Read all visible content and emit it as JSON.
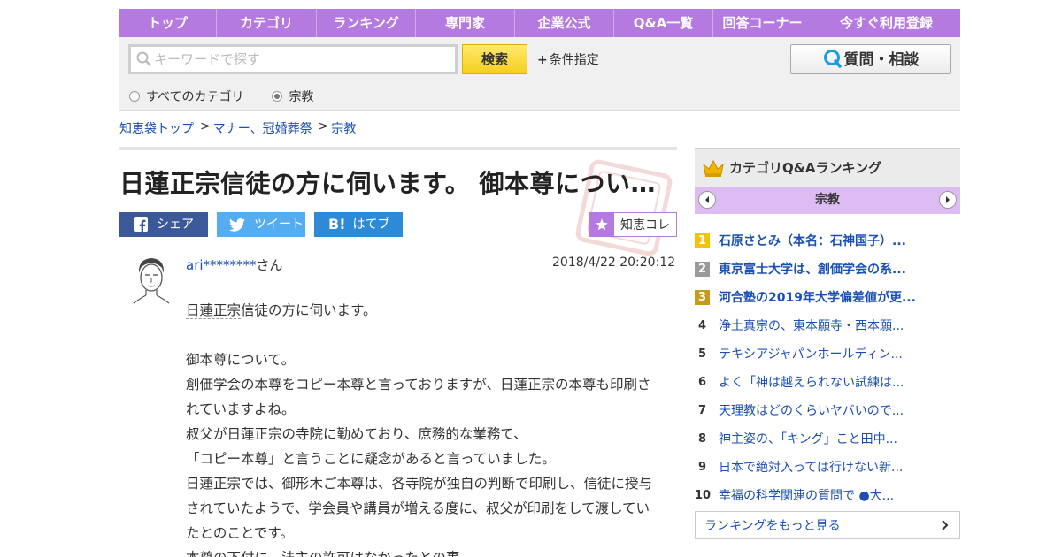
{
  "nav": {
    "items": [
      {
        "label": "トップ"
      },
      {
        "label": "カテゴリ"
      },
      {
        "label": "ランキング"
      },
      {
        "label": "専門家"
      },
      {
        "label": "企業公式"
      },
      {
        "label": "Q&A一覧"
      },
      {
        "label": "回答コーナー"
      },
      {
        "label": "今すぐ利用登録"
      }
    ]
  },
  "search": {
    "placeholder": "キーワードで探す",
    "button": "検索",
    "condition": "条件指定",
    "ask_button": "質問・相談",
    "scope_all": "すべてのカテゴリ",
    "scope_current": "宗教",
    "selected_scope": "current"
  },
  "breadcrumb": {
    "items": [
      {
        "label": "知恵袋トップ"
      },
      {
        "label": "マナー、冠婚葬祭"
      },
      {
        "label": "宗教"
      }
    ],
    "separator": ">"
  },
  "question": {
    "title": "日蓮正宗信徒の方に伺います。 御本尊につい…",
    "user": "ari********",
    "user_suffix": "さん",
    "date": "2018/4/22  20:20:12",
    "paragraphs": [
      {
        "kw": "日蓮正宗",
        "rest": "信徒の方に伺います。"
      },
      {
        "kw": "",
        "rest": ""
      },
      {
        "kw": "",
        "rest": "御本尊について。"
      },
      {
        "kw": "創価学会",
        "rest": "の本尊をコピー本尊と言っておりますが、日蓮正宗の本尊も印刷されていますよね。"
      },
      {
        "kw": "",
        "rest": "叔父が日蓮正宗の寺院に勤めており、庶務的な業務て、"
      },
      {
        "kw": "",
        "rest": "「コピー本尊」と言うことに疑念があると言っていました。"
      },
      {
        "kw": "",
        "rest": "日蓮正宗では、御形木ご本尊は、各寺院が独自の判断で印刷し、信徒に授与されていたようで、学会員や講員が増える度に、叔父が印刷をして渡していたとのことです。"
      },
      {
        "kw": "",
        "rest": "本尊の下付に、法主の許可はなかったとの事。"
      }
    ]
  },
  "share": {
    "facebook": "シェア",
    "twitter": "ツイート",
    "hatena_mark": "B!",
    "hatena": "はてブ",
    "chiecore": "知恵コレ"
  },
  "ranking": {
    "title": "カテゴリQ&Aランキング",
    "category": "宗教",
    "items": [
      {
        "rank": "1",
        "label": "石原さとみ（本名：石神国子）..."
      },
      {
        "rank": "2",
        "label": "東京富士大学は、創価学会の系..."
      },
      {
        "rank": "3",
        "label": "河合塾の2019年大学偏差値が更..."
      },
      {
        "rank": "4",
        "label": "浄土真宗の、東本願寺・西本願..."
      },
      {
        "rank": "5",
        "label": "テキシアジャパンホールディン..."
      },
      {
        "rank": "6",
        "label": "よく「神は越えられない試練は..."
      },
      {
        "rank": "7",
        "label": "天理教はどのくらいヤバいので..."
      },
      {
        "rank": "8",
        "label": "神主姿の、「キング」こと田中..."
      },
      {
        "rank": "9",
        "label": "日本で絶対入っては行けない新..."
      },
      {
        "rank": "10",
        "label": "幸福の科学関連の質問で ●大..."
      }
    ],
    "more": "ランキングをもっと見る"
  },
  "colors": {
    "nav": "#b57ae0",
    "link": "#1a4fb3",
    "search_button": "#f5cf1e",
    "facebook": "#3b5998",
    "twitter": "#55acee",
    "hatena": "#2d8ad6"
  }
}
